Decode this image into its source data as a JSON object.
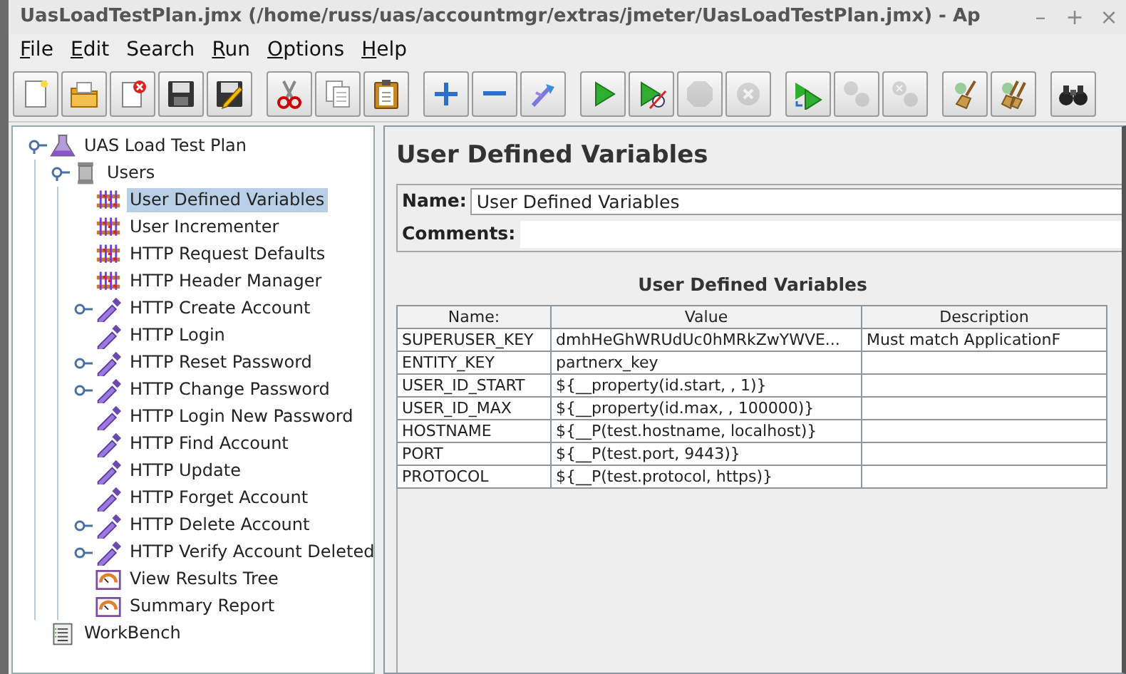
{
  "window": {
    "title": "UasLoadTestPlan.jmx (/home/russ/uas/accountmgr/extras/jmeter/UasLoadTestPlan.jmx) - Ap",
    "controls": [
      "–",
      "+",
      "×"
    ]
  },
  "menu": [
    {
      "label": "File",
      "underlined": true
    },
    {
      "label": "Edit",
      "underlined": true
    },
    {
      "label": "Search",
      "underlined": false
    },
    {
      "label": "Run",
      "underlined": true
    },
    {
      "label": "Options",
      "underlined": true
    },
    {
      "label": "Help",
      "underlined": true
    }
  ],
  "toolbar": [
    [
      {
        "kind": "new",
        "disabled": false
      },
      {
        "kind": "open",
        "disabled": false
      },
      {
        "kind": "close",
        "disabled": false
      },
      {
        "kind": "save",
        "disabled": false
      },
      {
        "kind": "saveas",
        "disabled": false
      }
    ],
    [
      {
        "kind": "cut",
        "disabled": false
      },
      {
        "kind": "copy",
        "disabled": false
      },
      {
        "kind": "paste",
        "disabled": false
      }
    ],
    [
      {
        "kind": "expand",
        "disabled": false
      },
      {
        "kind": "collapse",
        "disabled": false
      },
      {
        "kind": "toggle",
        "disabled": false
      }
    ],
    [
      {
        "kind": "start",
        "disabled": false
      },
      {
        "kind": "startnotimer",
        "disabled": false
      },
      {
        "kind": "stop",
        "disabled": true
      },
      {
        "kind": "shutdown",
        "disabled": true
      }
    ],
    [
      {
        "kind": "remotestart",
        "disabled": false
      },
      {
        "kind": "remotestop",
        "disabled": true
      },
      {
        "kind": "remoteexit",
        "disabled": true
      }
    ],
    [
      {
        "kind": "clear",
        "disabled": false
      },
      {
        "kind": "clearall",
        "disabled": false
      }
    ],
    [
      {
        "kind": "search",
        "disabled": false
      }
    ]
  ],
  "tree": [
    {
      "label": "UAS Load Test Plan",
      "kind": "testplan",
      "selected": false,
      "expanded": true,
      "children": [
        {
          "label": "Users",
          "kind": "threadgroup",
          "selected": false,
          "expanded": true,
          "children": [
            {
              "label": "User Defined Variables",
              "kind": "config",
              "selected": true
            },
            {
              "label": "User Incrementer",
              "kind": "config",
              "selected": false
            },
            {
              "label": "HTTP Request Defaults",
              "kind": "config",
              "selected": false
            },
            {
              "label": "HTTP Header Manager",
              "kind": "config",
              "selected": false
            },
            {
              "label": "HTTP Create Account",
              "kind": "sampler",
              "selected": false,
              "expanded": false
            },
            {
              "label": "HTTP Login",
              "kind": "sampler",
              "selected": false
            },
            {
              "label": "HTTP Reset Password",
              "kind": "sampler",
              "selected": false,
              "expanded": false
            },
            {
              "label": "HTTP Change Password",
              "kind": "sampler",
              "selected": false,
              "expanded": false
            },
            {
              "label": "HTTP Login New Password",
              "kind": "sampler",
              "selected": false
            },
            {
              "label": "HTTP Find Account",
              "kind": "sampler",
              "selected": false
            },
            {
              "label": "HTTP Update",
              "kind": "sampler",
              "selected": false
            },
            {
              "label": "HTTP Forget Account",
              "kind": "sampler",
              "selected": false
            },
            {
              "label": "HTTP Delete Account",
              "kind": "sampler",
              "selected": false,
              "expanded": false
            },
            {
              "label": "HTTP Verify Account Deleted",
              "kind": "sampler",
              "selected": false,
              "expanded": false
            },
            {
              "label": "View Results Tree",
              "kind": "listener",
              "selected": false
            },
            {
              "label": "Summary Report",
              "kind": "listener",
              "selected": false
            }
          ]
        }
      ]
    },
    {
      "label": "WorkBench",
      "kind": "workbench",
      "selected": false
    }
  ],
  "editor": {
    "title": "User Defined Variables",
    "name_label": "Name:",
    "name_value": "User Defined Variables",
    "comments_label": "Comments:",
    "table": {
      "title": "User Defined Variables",
      "columns": [
        "Name:",
        "Value",
        "Description"
      ],
      "rows": [
        [
          "SUPERUSER_KEY",
          "dmhHeGhWRUdUc0hMRkZwYWVE...",
          "Must match ApplicationF"
        ],
        [
          "ENTITY_KEY",
          "partnerx_key",
          ""
        ],
        [
          "USER_ID_START",
          "${__property(id.start, , 1)}",
          ""
        ],
        [
          "USER_ID_MAX",
          "${__property(id.max, , 100000)}",
          ""
        ],
        [
          "HOSTNAME",
          "${__P(test.hostname, localhost)}",
          ""
        ],
        [
          "PORT",
          "${__P(test.port, 9443)}",
          ""
        ],
        [
          "PROTOCOL",
          "${__P(test.protocol, https)}",
          ""
        ]
      ]
    }
  }
}
